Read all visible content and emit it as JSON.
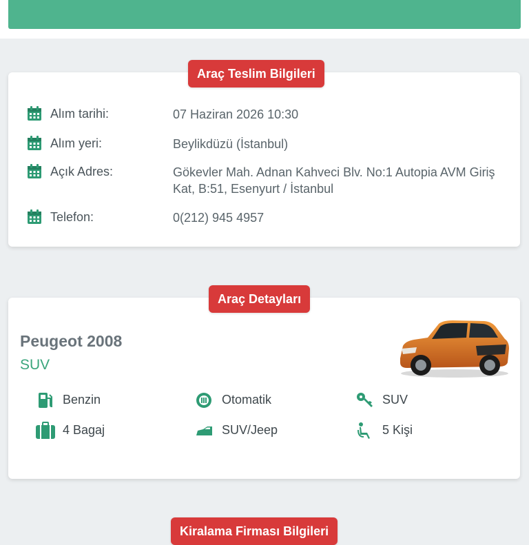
{
  "colors": {
    "accent_green": "#4fb48e",
    "badge_red": "#d83a3a",
    "icon_green": "#2e9b74"
  },
  "delivery": {
    "title": "Araç Teslim Bilgileri",
    "rows": [
      {
        "label": "Alım tarihi:",
        "value": "07 Haziran 2026 10:30",
        "icon": "calendar-icon"
      },
      {
        "label": "Alım yeri:",
        "value": "Beylikdüzü (İstanbul)",
        "icon": "calendar-icon"
      },
      {
        "label": "Açık Adres:",
        "value": "Gökevler Mah. Adnan Kahveci Blv. No:1 Autopia AVM Giriş Kat, B:51, Esenyurt / İstanbul",
        "icon": "calendar-icon"
      },
      {
        "label": "Telefon:",
        "value": "0(212) 945 4957",
        "icon": "calendar-icon"
      }
    ]
  },
  "vehicle": {
    "title": "Araç Detayları",
    "name": "Peugeot 2008",
    "class": "SUV",
    "image": "car-image",
    "features": [
      {
        "text": "Benzin",
        "icon": "fuel-icon"
      },
      {
        "text": "Otomatik",
        "icon": "gearbox-icon"
      },
      {
        "text": "SUV",
        "icon": "key-icon"
      },
      {
        "text": "4 Bagaj",
        "icon": "luggage-icon"
      },
      {
        "text": "SUV/Jeep",
        "icon": "car-body-icon"
      },
      {
        "text": "5 Kişi",
        "icon": "seat-icon"
      }
    ]
  },
  "company": {
    "title": "Kiralama Firması Bilgileri"
  }
}
